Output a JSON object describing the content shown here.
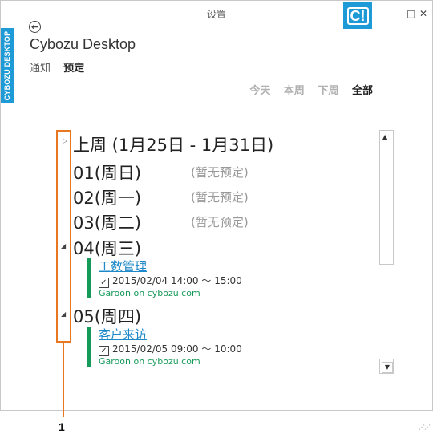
{
  "window": {
    "title": "设置",
    "logo_text": "C!",
    "side_tab": "CYBOZU DESKTOP",
    "app_title": "Cybozu Desktop",
    "controls": {
      "minimize": "—",
      "maximize": "□",
      "close": "✕"
    }
  },
  "nav": {
    "tabs": [
      {
        "label": "通知"
      },
      {
        "label": "预定"
      }
    ],
    "active": "预定"
  },
  "filters": [
    {
      "label": "今天"
    },
    {
      "label": "本周"
    },
    {
      "label": "下周"
    },
    {
      "label": "全部",
      "selected": true
    }
  ],
  "schedule": {
    "week_label": "上周 (1月25日 - 1月31日)",
    "days": [
      {
        "label": "01(周日)",
        "note": "(暂无预定)"
      },
      {
        "label": "02(周一)",
        "note": "(暂无预定)"
      },
      {
        "label": "03(周二)",
        "note": "(暂无预定)"
      },
      {
        "label": "04(周三)",
        "event": {
          "title": "工数管理",
          "time": "2015/02/04 14:00 ～ 15:00",
          "source": "Garoon on cybozu.com"
        }
      },
      {
        "label": "05(周四)",
        "event": {
          "title": "客户来访",
          "time": "2015/02/05 09:00 ～ 10:00",
          "source": "Garoon on cybozu.com"
        }
      }
    ]
  },
  "callout": {
    "label": "1"
  },
  "icons": {
    "back": "back-arrow-icon",
    "expand": "triangle-icon",
    "check": "checkbox-icon"
  },
  "colors": {
    "accent": "#1e9ad6",
    "event_bar": "#169a5a",
    "link": "#1e88c8",
    "callout": "#e87722"
  }
}
